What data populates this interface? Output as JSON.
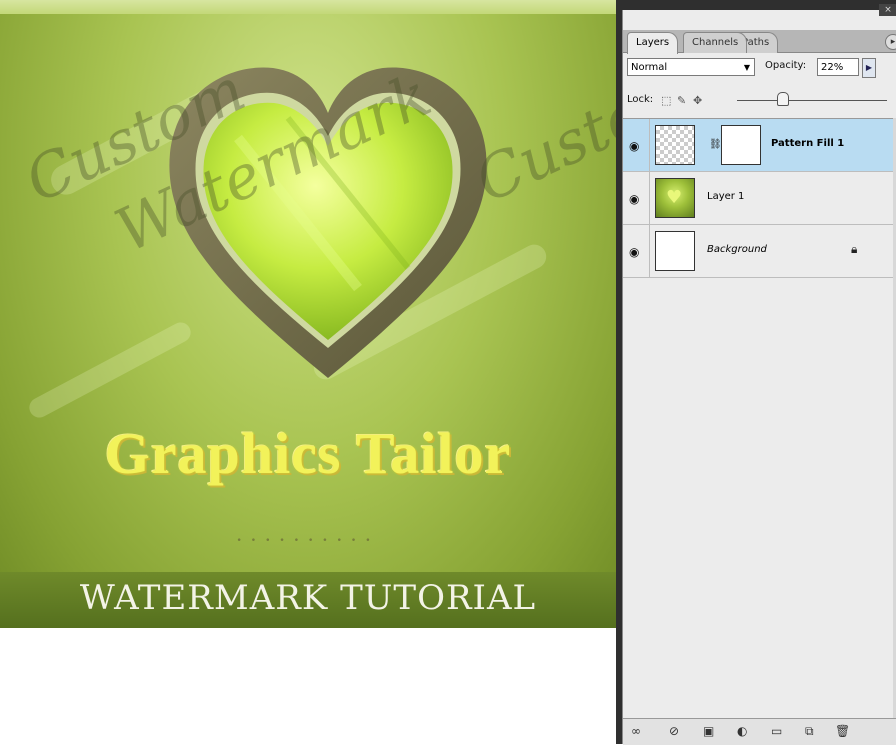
{
  "canvas": {
    "watermark_word_1": "Custom",
    "watermark_word_2": "Watermark",
    "brand_title": "Graphics Tailor",
    "subtitle": "WATERMARK TUTORIAL",
    "dots": "••••••••••"
  },
  "panel": {
    "tabs": [
      {
        "label": "Layers"
      },
      {
        "label": "Channels"
      },
      {
        "label": "Paths"
      }
    ],
    "blend_mode": "Normal",
    "opacity_label": "Opacity:",
    "opacity_value": "22%",
    "lock_label": "Lock:",
    "layers": [
      {
        "name": "Pattern Fill 1",
        "selected": true
      },
      {
        "name": "Layer 1",
        "selected": false
      },
      {
        "name": "Background",
        "selected": false
      }
    ]
  },
  "colors": {
    "canvas_green": "#a9c452",
    "heart_frame": "#6e6a48",
    "brand_yellow": "#f2f25a",
    "selected_layer": "#b9dcf2"
  },
  "icons": [
    "eye-icon",
    "chain-link-icon",
    "lock-icon",
    "link-layers-icon",
    "fx-icon",
    "mask-icon",
    "adjustment-icon",
    "folder-icon",
    "new-layer-icon",
    "trash-icon"
  ]
}
